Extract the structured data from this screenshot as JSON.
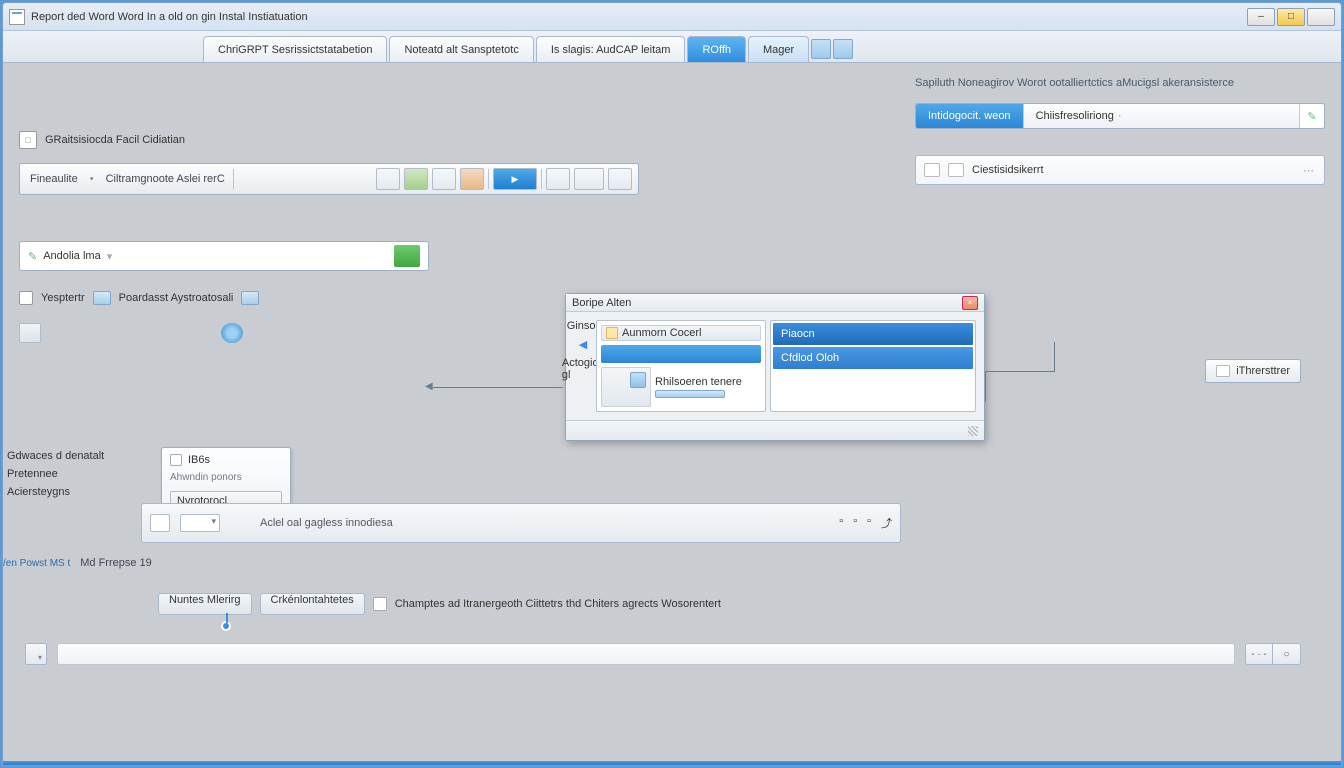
{
  "titlebar": {
    "title": "Report ded Word   Word In a old on gin Instal Instiatuation"
  },
  "win_controls": {
    "min": "–",
    "max": "□",
    "close": ""
  },
  "tabs": [
    {
      "label": "ChriGRPT Sesrissictstatabetion"
    },
    {
      "label": "Noteatd alt Sansptetotc"
    },
    {
      "label": "Is slagis: AudCAP leitam"
    },
    {
      "label": "ROffh"
    },
    {
      "label": "Mager"
    }
  ],
  "left": {
    "section1_label": "GRaitsisiocda Facil Cidiatian",
    "toolbar": {
      "t1": "Fineaulite",
      "t2": "Ciltramgnoote Aslei rerC"
    },
    "input_value": "Andolia lma",
    "chk1": "Yesptertr",
    "chk2": "Poardasst Aystroatosali",
    "sidelist": [
      "Gdwaces d denatalt",
      "Pretennee",
      "Aciersteygns"
    ],
    "menu": {
      "head": "IB6s",
      "sub": "Ahwndin ponors",
      "btn": "Nvrotorocl"
    },
    "lowerbar_text": "Aclel oal gagless innodiesa",
    "lb_link": "/en Powst MS t",
    "lb_btn1": "Nuntes Mlerirg",
    "lb_btn2": "Crkénlontahtetes",
    "md_label": "Md Frrepse 19",
    "caption": "Champtes ad Itranergeoth Ciittetrs thd Chiters agrects Wosorentert",
    "seg1": "- · -",
    "seg2": "○"
  },
  "right": {
    "head": "Sapiluth Noneagirov Worot ootalliertctics aMucigsl akeransisterce",
    "tab_active": "Intidogocit. weon",
    "tab_other": "Chiisfresoliriong",
    "field_label": "Ciestisidsikerrt"
  },
  "dialog": {
    "title": "Boripe Alten",
    "side1": "Ginsor",
    "side2": "Actogios gl",
    "dh": "Aunmorn Cocerl",
    "row2a": "Rhilsoeren tenere",
    "sel": "Piaocn",
    "opt": "Cfdlod Oloh"
  },
  "ext_btn": "iThrersttrer"
}
